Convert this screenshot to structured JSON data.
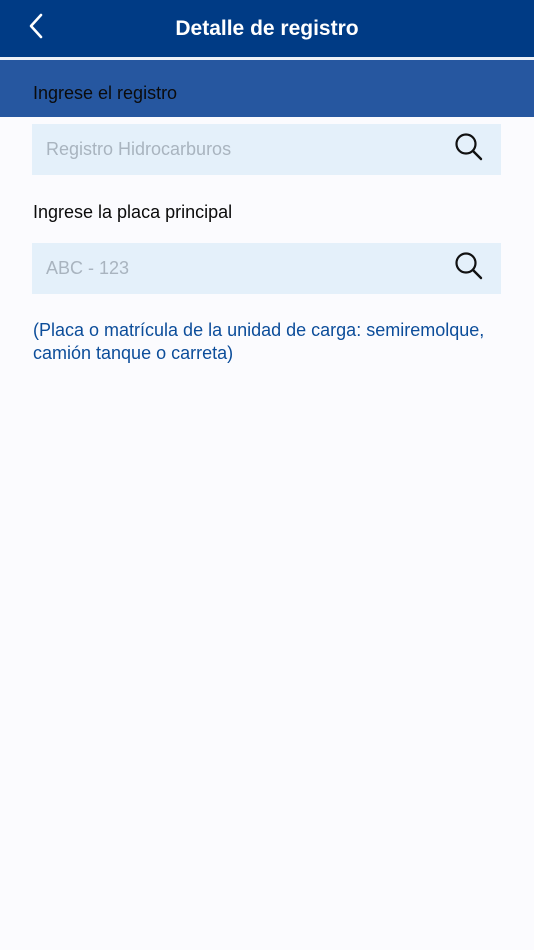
{
  "nav": {
    "title": "Detalle de registro",
    "back_icon": "chevron-left-icon"
  },
  "form": {
    "registro": {
      "label": "Ingrese el registro",
      "placeholder": "Registro Hidrocarburos",
      "value": "",
      "search_icon": "search-icon"
    },
    "placa": {
      "label": "Ingrese la placa principal",
      "placeholder": "ABC - 123",
      "value": "",
      "search_icon": "search-icon"
    },
    "hint": "(Placa o matrícula de la unidad de carga: semiremolque, camión tanque o carreta)"
  },
  "colors": {
    "nav_background": "#003B85",
    "section_header_background": "#2657A0",
    "input_background": "#E4F0FA",
    "hint_text": "#0C4D9A",
    "page_background": "#FBFBFE"
  }
}
